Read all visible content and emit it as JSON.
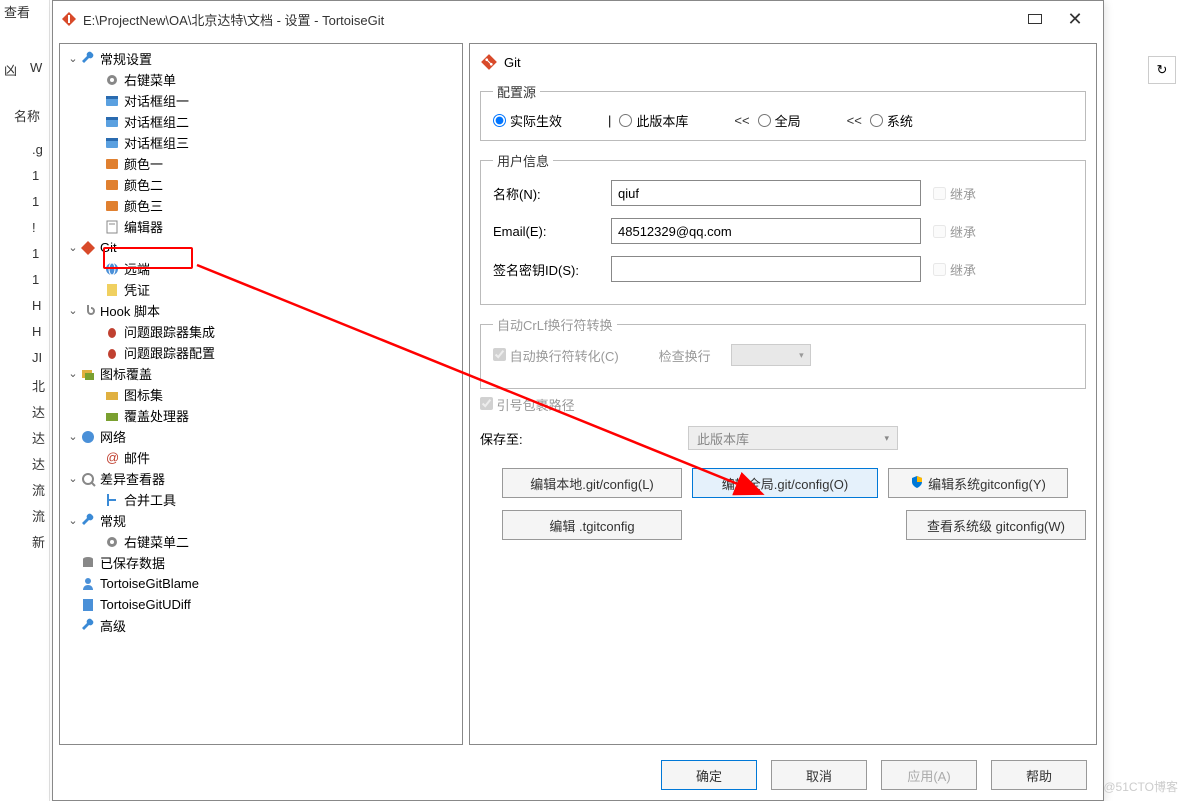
{
  "bg": {
    "view_label": "查看",
    "nav_w": "W",
    "name_header": "名称",
    "rows": [
      ".g",
      "1",
      "1",
      "!",
      "1",
      "1",
      "H",
      "H",
      "JI",
      "北",
      "达",
      "达",
      "达",
      "流",
      "流",
      "新"
    ],
    "nav_icon": "凶"
  },
  "dialog": {
    "title": "E:\\ProjectNew\\OA\\北京达特\\文档 - 设置 - TortoiseGit"
  },
  "tree": [
    {
      "d": 0,
      "c": "v",
      "i": "wrench-blue",
      "t": "常规设置"
    },
    {
      "d": 1,
      "c": "",
      "i": "gear",
      "t": "右键菜单"
    },
    {
      "d": 1,
      "c": "",
      "i": "window",
      "t": "对话框组一"
    },
    {
      "d": 1,
      "c": "",
      "i": "window",
      "t": "对话框组二"
    },
    {
      "d": 1,
      "c": "",
      "i": "window",
      "t": "对话框组三"
    },
    {
      "d": 1,
      "c": "",
      "i": "palette",
      "t": "颜色一"
    },
    {
      "d": 1,
      "c": "",
      "i": "palette",
      "t": "颜色二"
    },
    {
      "d": 1,
      "c": "",
      "i": "palette",
      "t": "颜色三"
    },
    {
      "d": 1,
      "c": "",
      "i": "editor",
      "t": "编辑器"
    },
    {
      "d": 0,
      "c": "v",
      "i": "git",
      "t": "Git"
    },
    {
      "d": 1,
      "c": "",
      "i": "globe",
      "t": "远端"
    },
    {
      "d": 1,
      "c": "",
      "i": "cert",
      "t": "凭证"
    },
    {
      "d": 0,
      "c": "v",
      "i": "hook",
      "t": "Hook 脚本"
    },
    {
      "d": 1,
      "c": "",
      "i": "bug",
      "t": "问题跟踪器集成"
    },
    {
      "d": 1,
      "c": "",
      "i": "bug",
      "t": "问题跟踪器配置"
    },
    {
      "d": 0,
      "c": "v",
      "i": "overlay",
      "t": "图标覆盖"
    },
    {
      "d": 1,
      "c": "",
      "i": "folder",
      "t": "图标集"
    },
    {
      "d": 1,
      "c": "",
      "i": "folder-g",
      "t": "覆盖处理器"
    },
    {
      "d": 0,
      "c": "v",
      "i": "net",
      "t": "网络"
    },
    {
      "d": 1,
      "c": "",
      "i": "mail",
      "t": "邮件"
    },
    {
      "d": 0,
      "c": "v",
      "i": "diff",
      "t": "差异查看器"
    },
    {
      "d": 1,
      "c": "",
      "i": "merge",
      "t": "合并工具"
    },
    {
      "d": 0,
      "c": "v",
      "i": "wrench-blue",
      "t": "常规"
    },
    {
      "d": 1,
      "c": "",
      "i": "gear",
      "t": "右键菜单二"
    },
    {
      "d": 0,
      "c": "",
      "i": "db",
      "t": "已保存数据"
    },
    {
      "d": 0,
      "c": "",
      "i": "blame",
      "t": "TortoiseGitBlame"
    },
    {
      "d": 0,
      "c": "",
      "i": "udiff",
      "t": "TortoiseGitUDiff"
    },
    {
      "d": 0,
      "c": "",
      "i": "wrench-blue",
      "t": "高级"
    }
  ],
  "panel": {
    "title": "Git",
    "config_source": {
      "legend": "配置源",
      "effective": "实际生效",
      "local": "此版本库",
      "global": "全局",
      "system": "系统",
      "arr": "<<",
      "bar": "|"
    },
    "user_info": {
      "legend": "用户信息",
      "name_label": "名称(N):",
      "name_value": "qiuf",
      "email_label": "Email(E):",
      "email_value": "48512329@qq.com",
      "sign_label": "签名密钥ID(S):",
      "sign_value": "",
      "inherit": "继承"
    },
    "crlf": {
      "legend": "自动CrLf换行符转换",
      "auto": "自动换行符转化(C)",
      "check": "检查换行"
    },
    "path_wrap": "引号包裹路径",
    "save_to": {
      "label": "保存至:",
      "value": "此版本库"
    },
    "buttons": {
      "local": "编辑本地.git/config(L)",
      "global": "编辑全局.git/config(O)",
      "system": "编辑系统gitconfig(Y)",
      "tgit": "编辑 .tgitconfig",
      "view_system": "查看系统级 gitconfig(W)"
    }
  },
  "footer": {
    "ok": "确定",
    "cancel": "取消",
    "apply": "应用(A)",
    "help": "帮助"
  },
  "watermark": "@51CTO博客"
}
